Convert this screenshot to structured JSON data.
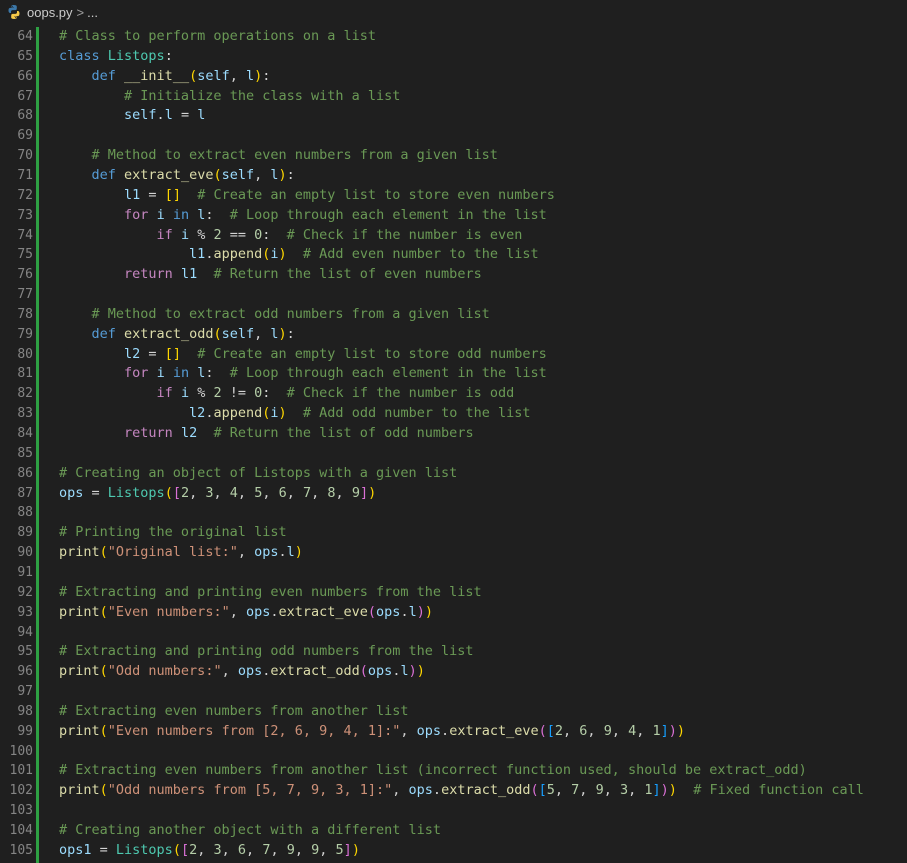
{
  "breadcrumb": {
    "file_name": "oops.py",
    "separator": ">",
    "more": "..."
  },
  "colors": {
    "background": "#1f1f1f",
    "line_number": "#858585",
    "modified_gutter": "#2ea043",
    "keyword": "#569cd6",
    "control": "#c586c0",
    "function": "#dcdcaa",
    "class": "#4ec9b0",
    "variable": "#9cdcfe",
    "number": "#b5cea8",
    "string": "#ce9178",
    "comment": "#6a9955",
    "bracket_1": "#ffd700",
    "bracket_2": "#da70d6",
    "bracket_3": "#179fff"
  },
  "lines": [
    {
      "n": "64",
      "t": [
        [
          "com",
          "# Class to perform operations on a list"
        ]
      ]
    },
    {
      "n": "65",
      "t": [
        [
          "kw",
          "class"
        ],
        [
          "pl",
          " "
        ],
        [
          "cls",
          "Listops"
        ],
        [
          "pl",
          ":"
        ]
      ]
    },
    {
      "n": "66",
      "t": [
        [
          "pl",
          "    "
        ],
        [
          "kw",
          "def"
        ],
        [
          "pl",
          " "
        ],
        [
          "fn",
          "__init__"
        ],
        [
          "b1",
          "("
        ],
        [
          "var",
          "self"
        ],
        [
          "pl",
          ", "
        ],
        [
          "var",
          "l"
        ],
        [
          "b1",
          ")"
        ],
        [
          "pl",
          ":"
        ]
      ]
    },
    {
      "n": "67",
      "t": [
        [
          "pl",
          "        "
        ],
        [
          "com",
          "# Initialize the class with a list"
        ]
      ]
    },
    {
      "n": "68",
      "t": [
        [
          "pl",
          "        "
        ],
        [
          "var",
          "self"
        ],
        [
          "pl",
          "."
        ],
        [
          "var",
          "l"
        ],
        [
          "op",
          " = "
        ],
        [
          "var",
          "l"
        ]
      ]
    },
    {
      "n": "69",
      "t": []
    },
    {
      "n": "70",
      "t": [
        [
          "pl",
          "    "
        ],
        [
          "com",
          "# Method to extract even numbers from a given list"
        ]
      ]
    },
    {
      "n": "71",
      "t": [
        [
          "pl",
          "    "
        ],
        [
          "kw",
          "def"
        ],
        [
          "pl",
          " "
        ],
        [
          "fn",
          "extract_eve"
        ],
        [
          "b1",
          "("
        ],
        [
          "var",
          "self"
        ],
        [
          "pl",
          ", "
        ],
        [
          "var",
          "l"
        ],
        [
          "b1",
          ")"
        ],
        [
          "pl",
          ":"
        ]
      ]
    },
    {
      "n": "72",
      "t": [
        [
          "pl",
          "        "
        ],
        [
          "var",
          "l1"
        ],
        [
          "op",
          " = "
        ],
        [
          "b1",
          "[]"
        ],
        [
          "pl",
          "  "
        ],
        [
          "com",
          "# Create an empty list to store even numbers"
        ]
      ]
    },
    {
      "n": "73",
      "t": [
        [
          "pl",
          "        "
        ],
        [
          "ctl",
          "for"
        ],
        [
          "pl",
          " "
        ],
        [
          "var",
          "i"
        ],
        [
          "pl",
          " "
        ],
        [
          "kw",
          "in"
        ],
        [
          "pl",
          " "
        ],
        [
          "var",
          "l"
        ],
        [
          "pl",
          ":  "
        ],
        [
          "com",
          "# Loop through each element in the list"
        ]
      ]
    },
    {
      "n": "74",
      "t": [
        [
          "pl",
          "            "
        ],
        [
          "ctl",
          "if"
        ],
        [
          "pl",
          " "
        ],
        [
          "var",
          "i"
        ],
        [
          "op",
          " % "
        ],
        [
          "num",
          "2"
        ],
        [
          "op",
          " == "
        ],
        [
          "num",
          "0"
        ],
        [
          "pl",
          ":  "
        ],
        [
          "com",
          "# Check if the number is even"
        ]
      ]
    },
    {
      "n": "75",
      "t": [
        [
          "pl",
          "                "
        ],
        [
          "var",
          "l1"
        ],
        [
          "pl",
          "."
        ],
        [
          "fn",
          "append"
        ],
        [
          "b1",
          "("
        ],
        [
          "var",
          "i"
        ],
        [
          "b1",
          ")"
        ],
        [
          "pl",
          "  "
        ],
        [
          "com",
          "# Add even number to the list"
        ]
      ]
    },
    {
      "n": "76",
      "t": [
        [
          "pl",
          "        "
        ],
        [
          "ctl",
          "return"
        ],
        [
          "pl",
          " "
        ],
        [
          "var",
          "l1"
        ],
        [
          "pl",
          "  "
        ],
        [
          "com",
          "# Return the list of even numbers"
        ]
      ]
    },
    {
      "n": "77",
      "t": []
    },
    {
      "n": "78",
      "t": [
        [
          "pl",
          "    "
        ],
        [
          "com",
          "# Method to extract odd numbers from a given list"
        ]
      ]
    },
    {
      "n": "79",
      "t": [
        [
          "pl",
          "    "
        ],
        [
          "kw",
          "def"
        ],
        [
          "pl",
          " "
        ],
        [
          "fn",
          "extract_odd"
        ],
        [
          "b1",
          "("
        ],
        [
          "var",
          "self"
        ],
        [
          "pl",
          ", "
        ],
        [
          "var",
          "l"
        ],
        [
          "b1",
          ")"
        ],
        [
          "pl",
          ":"
        ]
      ]
    },
    {
      "n": "80",
      "t": [
        [
          "pl",
          "        "
        ],
        [
          "var",
          "l2"
        ],
        [
          "op",
          " = "
        ],
        [
          "b1",
          "[]"
        ],
        [
          "pl",
          "  "
        ],
        [
          "com",
          "# Create an empty list to store odd numbers"
        ]
      ]
    },
    {
      "n": "81",
      "t": [
        [
          "pl",
          "        "
        ],
        [
          "ctl",
          "for"
        ],
        [
          "pl",
          " "
        ],
        [
          "var",
          "i"
        ],
        [
          "pl",
          " "
        ],
        [
          "kw",
          "in"
        ],
        [
          "pl",
          " "
        ],
        [
          "var",
          "l"
        ],
        [
          "pl",
          ":  "
        ],
        [
          "com",
          "# Loop through each element in the list"
        ]
      ]
    },
    {
      "n": "82",
      "t": [
        [
          "pl",
          "            "
        ],
        [
          "ctl",
          "if"
        ],
        [
          "pl",
          " "
        ],
        [
          "var",
          "i"
        ],
        [
          "op",
          " % "
        ],
        [
          "num",
          "2"
        ],
        [
          "op",
          " != "
        ],
        [
          "num",
          "0"
        ],
        [
          "pl",
          ":  "
        ],
        [
          "com",
          "# Check if the number is odd"
        ]
      ]
    },
    {
      "n": "83",
      "t": [
        [
          "pl",
          "                "
        ],
        [
          "var",
          "l2"
        ],
        [
          "pl",
          "."
        ],
        [
          "fn",
          "append"
        ],
        [
          "b1",
          "("
        ],
        [
          "var",
          "i"
        ],
        [
          "b1",
          ")"
        ],
        [
          "pl",
          "  "
        ],
        [
          "com",
          "# Add odd number to the list"
        ]
      ]
    },
    {
      "n": "84",
      "t": [
        [
          "pl",
          "        "
        ],
        [
          "ctl",
          "return"
        ],
        [
          "pl",
          " "
        ],
        [
          "var",
          "l2"
        ],
        [
          "pl",
          "  "
        ],
        [
          "com",
          "# Return the list of odd numbers"
        ]
      ]
    },
    {
      "n": "85",
      "t": []
    },
    {
      "n": "86",
      "t": [
        [
          "com",
          "# Creating an object of Listops with a given list"
        ]
      ]
    },
    {
      "n": "87",
      "t": [
        [
          "var",
          "ops"
        ],
        [
          "op",
          " = "
        ],
        [
          "cls",
          "Listops"
        ],
        [
          "b1",
          "("
        ],
        [
          "b2",
          "["
        ],
        [
          "num",
          "2"
        ],
        [
          "pl",
          ", "
        ],
        [
          "num",
          "3"
        ],
        [
          "pl",
          ", "
        ],
        [
          "num",
          "4"
        ],
        [
          "pl",
          ", "
        ],
        [
          "num",
          "5"
        ],
        [
          "pl",
          ", "
        ],
        [
          "num",
          "6"
        ],
        [
          "pl",
          ", "
        ],
        [
          "num",
          "7"
        ],
        [
          "pl",
          ", "
        ],
        [
          "num",
          "8"
        ],
        [
          "pl",
          ", "
        ],
        [
          "num",
          "9"
        ],
        [
          "b2",
          "]"
        ],
        [
          "b1",
          ")"
        ]
      ]
    },
    {
      "n": "88",
      "t": []
    },
    {
      "n": "89",
      "t": [
        [
          "com",
          "# Printing the original list"
        ]
      ]
    },
    {
      "n": "90",
      "t": [
        [
          "fn",
          "print"
        ],
        [
          "b1",
          "("
        ],
        [
          "str",
          "\"Original list:\""
        ],
        [
          "pl",
          ", "
        ],
        [
          "var",
          "ops"
        ],
        [
          "pl",
          "."
        ],
        [
          "var",
          "l"
        ],
        [
          "b1",
          ")"
        ]
      ]
    },
    {
      "n": "91",
      "t": []
    },
    {
      "n": "92",
      "t": [
        [
          "com",
          "# Extracting and printing even numbers from the list"
        ]
      ]
    },
    {
      "n": "93",
      "t": [
        [
          "fn",
          "print"
        ],
        [
          "b1",
          "("
        ],
        [
          "str",
          "\"Even numbers:\""
        ],
        [
          "pl",
          ", "
        ],
        [
          "var",
          "ops"
        ],
        [
          "pl",
          "."
        ],
        [
          "fn",
          "extract_eve"
        ],
        [
          "b2",
          "("
        ],
        [
          "var",
          "ops"
        ],
        [
          "pl",
          "."
        ],
        [
          "var",
          "l"
        ],
        [
          "b2",
          ")"
        ],
        [
          "b1",
          ")"
        ]
      ]
    },
    {
      "n": "94",
      "t": []
    },
    {
      "n": "95",
      "t": [
        [
          "com",
          "# Extracting and printing odd numbers from the list"
        ]
      ]
    },
    {
      "n": "96",
      "t": [
        [
          "fn",
          "print"
        ],
        [
          "b1",
          "("
        ],
        [
          "str",
          "\"Odd numbers:\""
        ],
        [
          "pl",
          ", "
        ],
        [
          "var",
          "ops"
        ],
        [
          "pl",
          "."
        ],
        [
          "fn",
          "extract_odd"
        ],
        [
          "b2",
          "("
        ],
        [
          "var",
          "ops"
        ],
        [
          "pl",
          "."
        ],
        [
          "var",
          "l"
        ],
        [
          "b2",
          ")"
        ],
        [
          "b1",
          ")"
        ]
      ]
    },
    {
      "n": "97",
      "t": []
    },
    {
      "n": "98",
      "t": [
        [
          "com",
          "# Extracting even numbers from another list"
        ]
      ]
    },
    {
      "n": "99",
      "t": [
        [
          "fn",
          "print"
        ],
        [
          "b1",
          "("
        ],
        [
          "str",
          "\"Even numbers from [2, 6, 9, 4, 1]:\""
        ],
        [
          "pl",
          ", "
        ],
        [
          "var",
          "ops"
        ],
        [
          "pl",
          "."
        ],
        [
          "fn",
          "extract_eve"
        ],
        [
          "b2",
          "("
        ],
        [
          "b3",
          "["
        ],
        [
          "num",
          "2"
        ],
        [
          "pl",
          ", "
        ],
        [
          "num",
          "6"
        ],
        [
          "pl",
          ", "
        ],
        [
          "num",
          "9"
        ],
        [
          "pl",
          ", "
        ],
        [
          "num",
          "4"
        ],
        [
          "pl",
          ", "
        ],
        [
          "num",
          "1"
        ],
        [
          "b3",
          "]"
        ],
        [
          "b2",
          ")"
        ],
        [
          "b1",
          ")"
        ]
      ]
    },
    {
      "n": "100",
      "t": []
    },
    {
      "n": "101",
      "t": [
        [
          "com",
          "# Extracting even numbers from another list (incorrect function used, should be extract_odd)"
        ]
      ]
    },
    {
      "n": "102",
      "t": [
        [
          "fn",
          "print"
        ],
        [
          "b1",
          "("
        ],
        [
          "str",
          "\"Odd numbers from [5, 7, 9, 3, 1]:\""
        ],
        [
          "pl",
          ", "
        ],
        [
          "var",
          "ops"
        ],
        [
          "pl",
          "."
        ],
        [
          "fn",
          "extract_odd"
        ],
        [
          "b2",
          "("
        ],
        [
          "b3",
          "["
        ],
        [
          "num",
          "5"
        ],
        [
          "pl",
          ", "
        ],
        [
          "num",
          "7"
        ],
        [
          "pl",
          ", "
        ],
        [
          "num",
          "9"
        ],
        [
          "pl",
          ", "
        ],
        [
          "num",
          "3"
        ],
        [
          "pl",
          ", "
        ],
        [
          "num",
          "1"
        ],
        [
          "b3",
          "]"
        ],
        [
          "b2",
          ")"
        ],
        [
          "b1",
          ")"
        ],
        [
          "pl",
          "  "
        ],
        [
          "com",
          "# Fixed function call"
        ]
      ]
    },
    {
      "n": "103",
      "t": []
    },
    {
      "n": "104",
      "t": [
        [
          "com",
          "# Creating another object with a different list"
        ]
      ]
    },
    {
      "n": "105",
      "t": [
        [
          "var",
          "ops1"
        ],
        [
          "op",
          " = "
        ],
        [
          "cls",
          "Listops"
        ],
        [
          "b1",
          "("
        ],
        [
          "b2",
          "["
        ],
        [
          "num",
          "2"
        ],
        [
          "pl",
          ", "
        ],
        [
          "num",
          "3"
        ],
        [
          "pl",
          ", "
        ],
        [
          "num",
          "6"
        ],
        [
          "pl",
          ", "
        ],
        [
          "num",
          "7"
        ],
        [
          "pl",
          ", "
        ],
        [
          "num",
          "9"
        ],
        [
          "pl",
          ", "
        ],
        [
          "num",
          "9"
        ],
        [
          "pl",
          ", "
        ],
        [
          "num",
          "5"
        ],
        [
          "b2",
          "]"
        ],
        [
          "b1",
          ")"
        ]
      ]
    }
  ]
}
